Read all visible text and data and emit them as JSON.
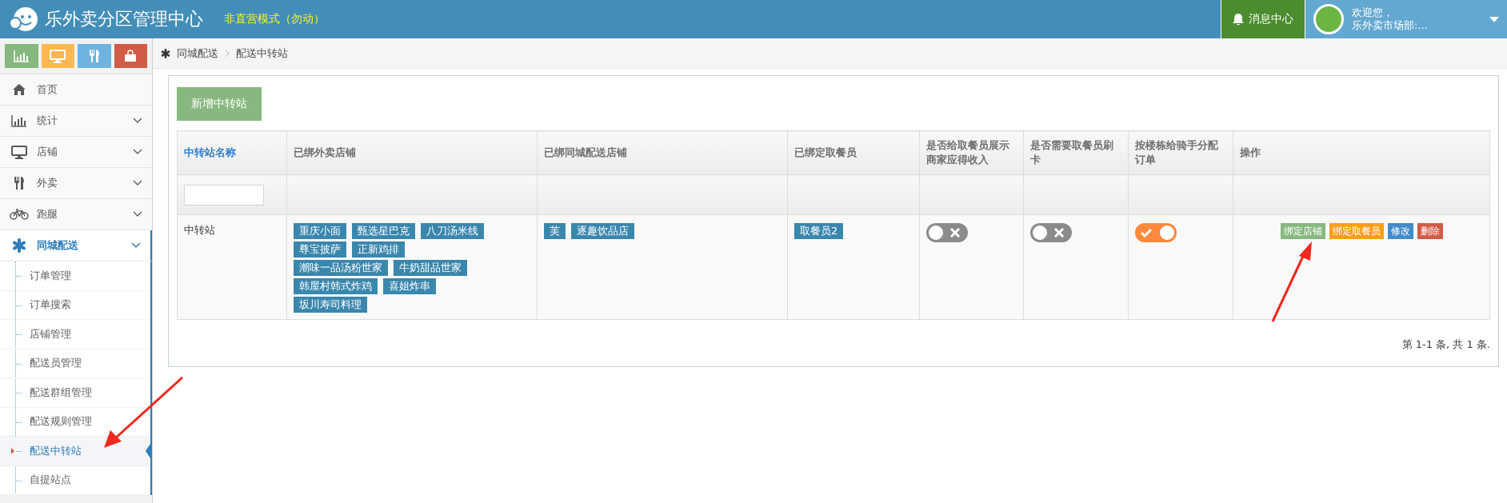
{
  "header": {
    "title": "乐外卖分区管理中心",
    "mode": "非直营模式（勿动）",
    "messages": "消息中心",
    "welcome": "欢迎您，",
    "user": "乐外卖市场部:..."
  },
  "shortcuts": [
    {
      "kind": "chart",
      "color": "#87b87f"
    },
    {
      "kind": "monitor",
      "color": "#ffb752"
    },
    {
      "kind": "food",
      "color": "#6fb3e0"
    },
    {
      "kind": "bag",
      "color": "#d15b47"
    }
  ],
  "sidebar": {
    "items": [
      {
        "label": "首页",
        "kind": "home",
        "expanded": false
      },
      {
        "label": "统计",
        "kind": "chart",
        "expanded": false
      },
      {
        "label": "店铺",
        "kind": "monitor",
        "expanded": false
      },
      {
        "label": "外卖",
        "kind": "food",
        "expanded": false
      },
      {
        "label": "跑腿",
        "kind": "bike",
        "expanded": false
      },
      {
        "label": "同城配送",
        "kind": "asterisk",
        "expanded": true,
        "children": [
          {
            "label": "订单管理",
            "selected": false
          },
          {
            "label": "订单搜索",
            "selected": false
          },
          {
            "label": "店铺管理",
            "selected": false
          },
          {
            "label": "配送员管理",
            "selected": false
          },
          {
            "label": "配送群组管理",
            "selected": false
          },
          {
            "label": "配送规则管理",
            "selected": false
          },
          {
            "label": "配送中转站",
            "selected": true
          },
          {
            "label": "自提站点",
            "selected": false
          }
        ]
      }
    ]
  },
  "breadcrumb": [
    "同城配送",
    "配送中转站"
  ],
  "add_button": "新增中转站",
  "table": {
    "columns": [
      {
        "label": "中转站名称",
        "sortable": true
      },
      {
        "label": "已绑外卖店铺",
        "sortable": false
      },
      {
        "label": "已绑同城配送店铺",
        "sortable": false
      },
      {
        "label": "已绑定取餐员",
        "sortable": false
      },
      {
        "label": "是否给取餐员展示商家应得收入",
        "sortable": false
      },
      {
        "label": "是否需要取餐员刷卡",
        "sortable": false
      },
      {
        "label": "按楼栋给骑手分配订单",
        "sortable": false
      },
      {
        "label": "操作",
        "sortable": false
      }
    ],
    "rows": [
      {
        "name": "中转站",
        "takeout_shops": [
          "重庆小面",
          "甄选星巴克",
          "八刀汤米线",
          "尊宝披萨",
          "正新鸡排",
          "潮味一品汤粉世家",
          "牛奶甜品世家",
          "韩屋村韩式炸鸡",
          "喜姐炸串",
          "坂川寿司料理"
        ],
        "delivery_shops": [
          "芙",
          "逐趣饮品店"
        ],
        "pickers": [
          "取餐员2"
        ],
        "show_income": false,
        "require_card": false,
        "by_building": true,
        "actions": [
          {
            "label": "绑定店铺",
            "color": "#87b87f"
          },
          {
            "label": "绑定取餐员",
            "color": "#ff9e1b"
          },
          {
            "label": "修改",
            "color": "#428bca"
          },
          {
            "label": "删除",
            "color": "#d15b47"
          }
        ]
      }
    ]
  },
  "pagination": "第 1-1 条, 共 1 条."
}
